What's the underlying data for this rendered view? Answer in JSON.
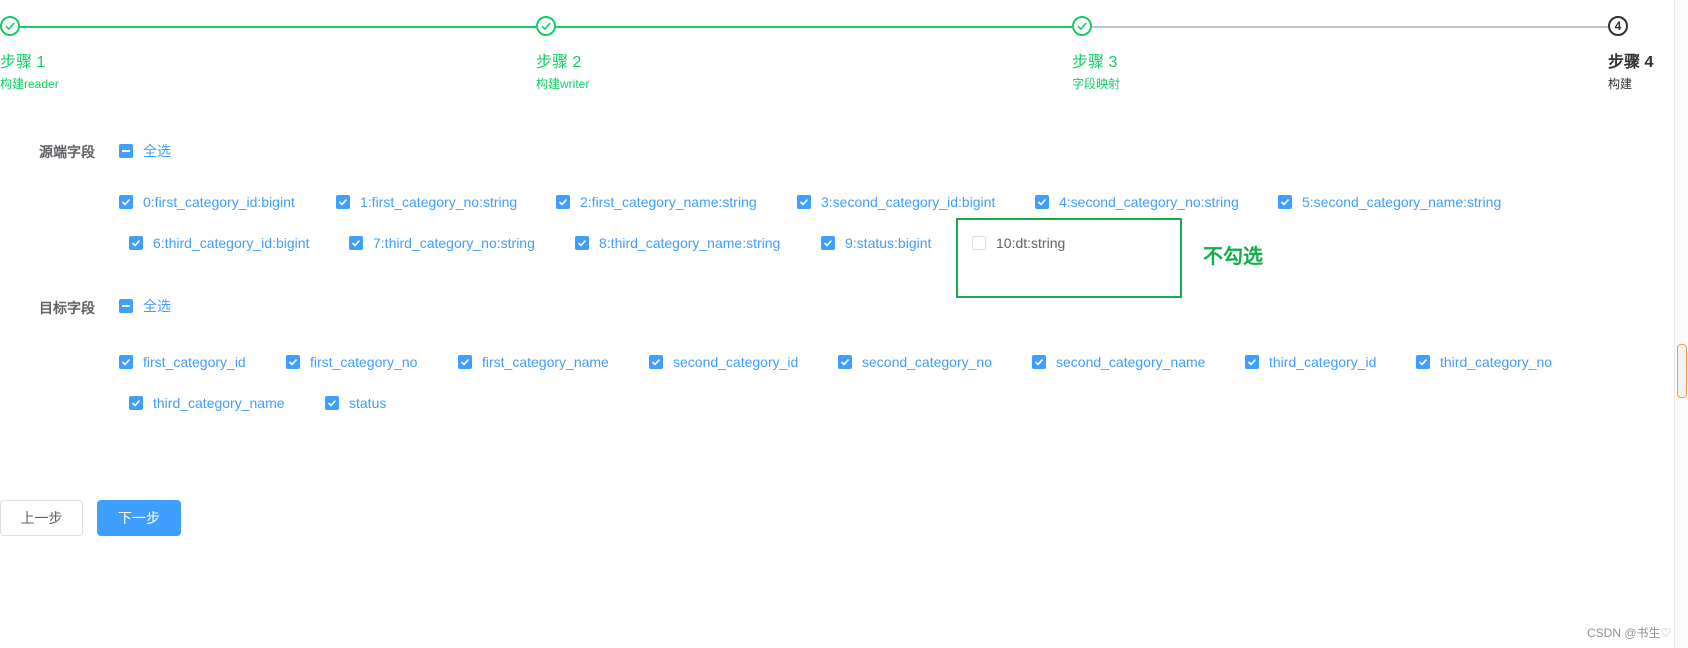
{
  "steps": [
    {
      "title": "步骤 1",
      "description": "构建reader",
      "status": "finished"
    },
    {
      "title": "步骤 2",
      "description": "构建writer",
      "status": "finished"
    },
    {
      "title": "步骤 3",
      "description": "字段映射",
      "status": "finished"
    },
    {
      "title": "步骤 4",
      "description": "构建",
      "status": "process",
      "number": "4"
    }
  ],
  "source": {
    "label": "源端字段",
    "select_all": "全选",
    "fields": [
      {
        "label": "0:first_category_id:bigint",
        "checked": true
      },
      {
        "label": "1:first_category_no:string",
        "checked": true
      },
      {
        "label": "2:first_category_name:string",
        "checked": true
      },
      {
        "label": "3:second_category_id:bigint",
        "checked": true
      },
      {
        "label": "4:second_category_no:string",
        "checked": true
      },
      {
        "label": "5:second_category_name:string",
        "checked": true
      },
      {
        "label": "6:third_category_id:bigint",
        "checked": true
      },
      {
        "label": "7:third_category_no:string",
        "checked": true
      },
      {
        "label": "8:third_category_name:string",
        "checked": true
      },
      {
        "label": "9:status:bigint",
        "checked": true
      },
      {
        "label": "10:dt:string",
        "checked": false
      }
    ]
  },
  "target": {
    "label": "目标字段",
    "select_all": "全选",
    "fields": [
      {
        "label": "first_category_id",
        "checked": true
      },
      {
        "label": "first_category_no",
        "checked": true
      },
      {
        "label": "first_category_name",
        "checked": true
      },
      {
        "label": "second_category_id",
        "checked": true
      },
      {
        "label": "second_category_no",
        "checked": true
      },
      {
        "label": "second_category_name",
        "checked": true
      },
      {
        "label": "third_category_id",
        "checked": true
      },
      {
        "label": "third_category_no",
        "checked": true
      },
      {
        "label": "third_category_name",
        "checked": true
      },
      {
        "label": "status",
        "checked": true
      }
    ]
  },
  "annotation": {
    "text": "不勾选"
  },
  "buttons": {
    "prev": "上一步",
    "next": "下一步"
  },
  "watermark": "CSDN @书生♡",
  "colors": {
    "finished": "#13ce66",
    "primary": "#409eff",
    "annotation": "#13ad4a"
  }
}
